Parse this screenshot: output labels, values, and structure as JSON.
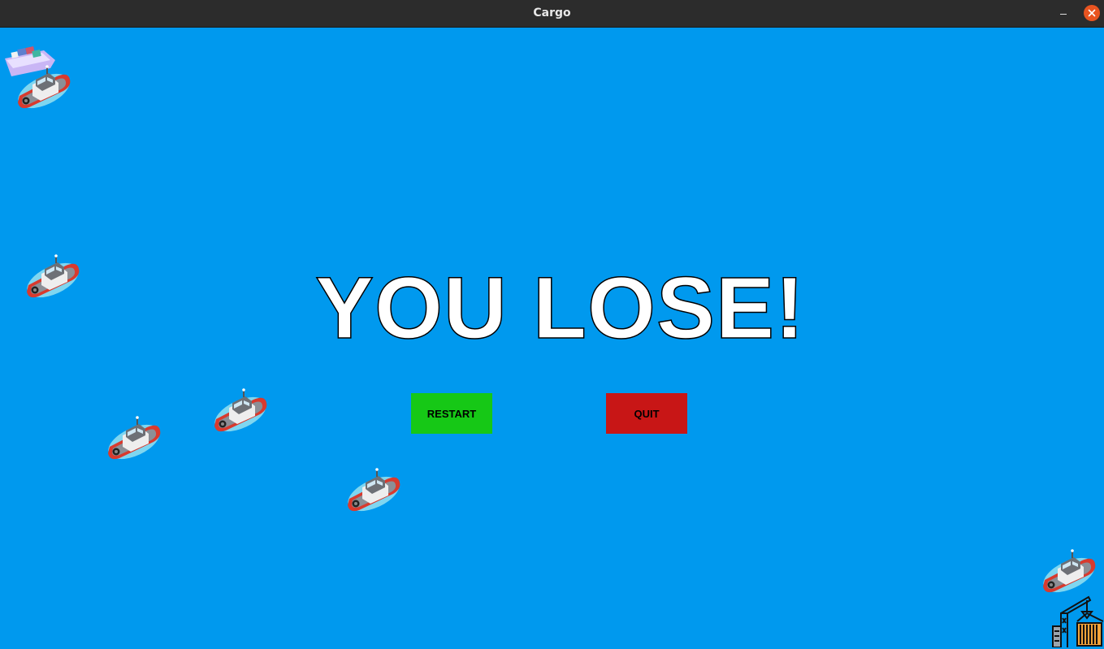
{
  "window": {
    "title": "Cargo"
  },
  "game": {
    "message": "YOU LOSE!",
    "buttons": {
      "restart_label": "RESTART",
      "quit_label": "QUIT"
    },
    "boat_count": 6
  },
  "colors": {
    "water": "#0099ee",
    "restart": "#16c816",
    "quit": "#c81616",
    "close": "#e95420",
    "titlebar": "#2c2c2c"
  },
  "icons": {
    "boat": "tugboat-icon",
    "ship": "cargo-ship-icon",
    "port": "port-crane-icon",
    "close": "close-icon",
    "minimize": "minimize-icon"
  }
}
